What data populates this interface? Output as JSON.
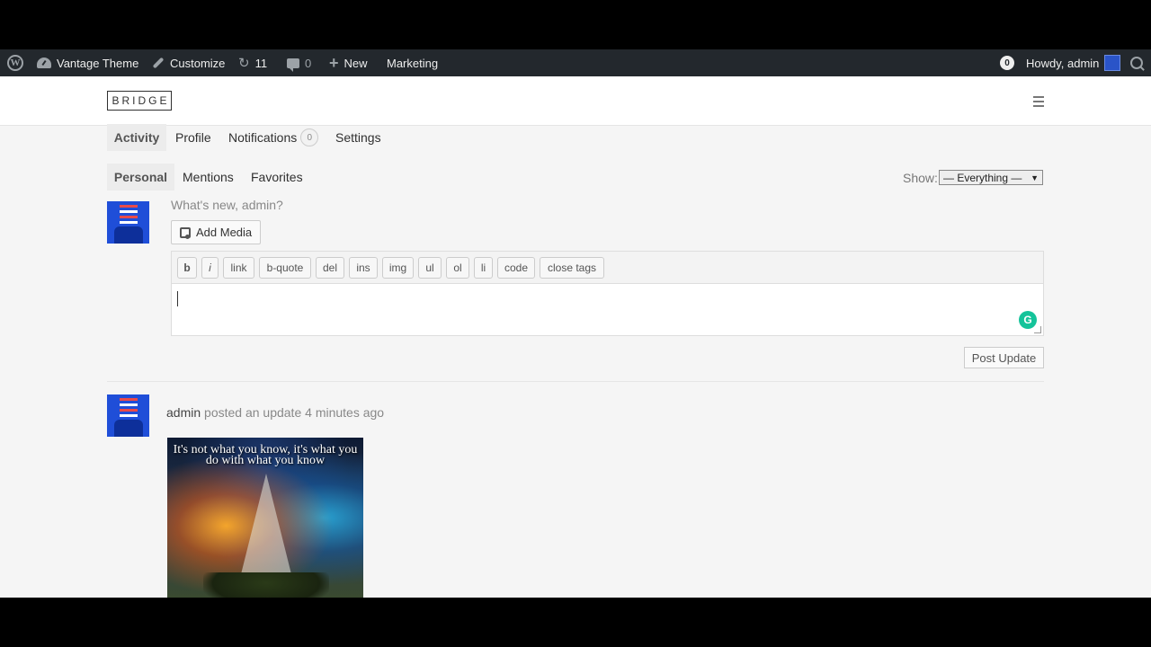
{
  "admin_bar": {
    "site_name": "Vantage Theme",
    "customize": "Customize",
    "updates_count": "11",
    "comments_count": "0",
    "new_label": "New",
    "marketing": "Marketing",
    "notifications_count": "0",
    "greeting": "Howdy, admin"
  },
  "site": {
    "logo": "BRIDGE"
  },
  "nav": {
    "activity": "Activity",
    "profile": "Profile",
    "notifications": "Notifications",
    "notifications_count": "0",
    "settings": "Settings"
  },
  "subnav": {
    "personal": "Personal",
    "mentions": "Mentions",
    "favorites": "Favorites"
  },
  "filter": {
    "show_label": "Show:",
    "selected": "— Everything —"
  },
  "post_form": {
    "prompt": "What's new, admin?",
    "add_media": "Add Media",
    "quicktags": [
      "b",
      "i",
      "link",
      "b-quote",
      "del",
      "ins",
      "img",
      "ul",
      "ol",
      "li",
      "code",
      "close tags"
    ],
    "submit": "Post Update"
  },
  "activity_item": {
    "user": "admin",
    "action": "posted an update",
    "time": "4 minutes ago",
    "image_quote": "It's not what you know, it's what you do with what you know"
  },
  "colors": {
    "admin_bar_bg": "#23282d",
    "page_bg": "#f5f5f5",
    "grammarly": "#15c39a",
    "avatar_blue": "#1f4ed8"
  }
}
